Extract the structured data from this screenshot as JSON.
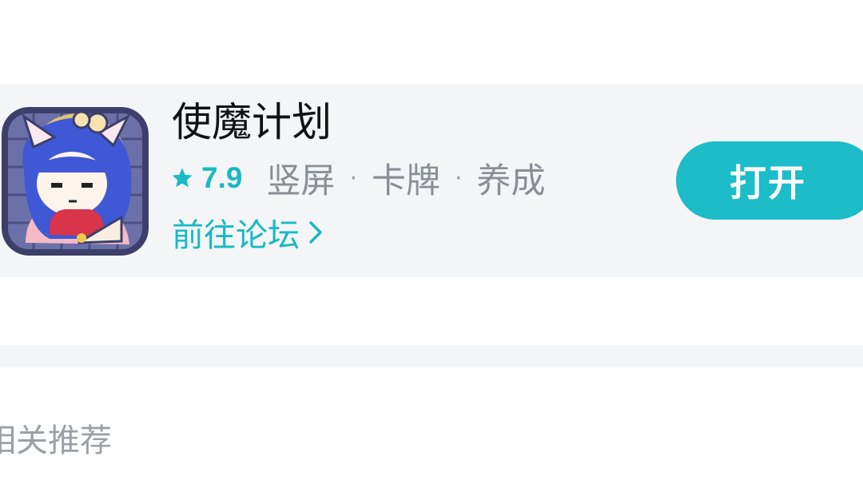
{
  "app": {
    "name": "使魔计划",
    "rating": "7.9",
    "tags": [
      "竖屏",
      "卡牌",
      "养成"
    ],
    "separator": "·",
    "forum_link": "前往论坛",
    "open_button": "打开"
  },
  "section": {
    "title": "相关推荐"
  },
  "colors": {
    "accent": "#19b9c5",
    "card_background": "#f4f5f7",
    "tag_text": "#8a8f96"
  },
  "icons": {
    "rating": "star-icon",
    "forum_link": "chevron-right-icon",
    "app": "app-icon"
  }
}
